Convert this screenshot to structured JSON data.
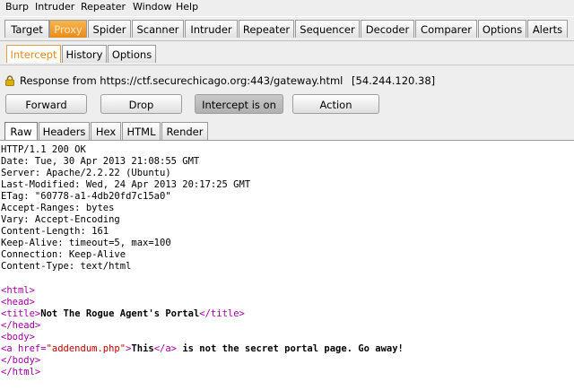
{
  "menu": [
    "Burp",
    "Intruder",
    "Repeater",
    "Window",
    "Help"
  ],
  "main_tabs": [
    "Target",
    "Proxy",
    "Spider",
    "Scanner",
    "Intruder",
    "Repeater",
    "Sequencer",
    "Decoder",
    "Comparer",
    "Options",
    "Alerts"
  ],
  "proxy_tabs": [
    "Intercept",
    "History",
    "Options"
  ],
  "request_info": {
    "text": "Response from https://ctf.securechicago.org:443/gateway.html",
    "ip": "[54.244.120.38]"
  },
  "buttons": {
    "forward": "Forward",
    "drop": "Drop",
    "intercept": "Intercept is on",
    "action": "Action"
  },
  "view_tabs": [
    "Raw",
    "Headers",
    "Hex",
    "HTML",
    "Render"
  ],
  "headers": [
    "HTTP/1.1 200 OK",
    "Date: Tue, 30 Apr 2013 21:08:55 GMT",
    "Server: Apache/2.2.22 (Ubuntu)",
    "Last-Modified: Wed, 24 Apr 2013 20:17:25 GMT",
    "ETag: \"60778-a1-4db20fd7c15a0\"",
    "Accept-Ranges: bytes",
    "Vary: Accept-Encoding",
    "Content-Length: 161",
    "Keep-Alive: timeout=5, max=100",
    "Connection: Keep-Alive",
    "Content-Type: text/html"
  ],
  "body": {
    "html_open": "<html>",
    "head_open": "<head>",
    "title_open": "<title>",
    "title_text": "Not The Rogue Agent's Portal",
    "title_close": "</title>",
    "head_close": "</head>",
    "body_open": "<body>",
    "a_open_start": "<a ",
    "a_href_attr": "href=",
    "a_href_val": "\"addendum.php\"",
    "a_open_end": ">",
    "a_text": "This",
    "a_close": "</a>",
    "after_link": " is not the secret portal page. Go away!",
    "body_close": "</body>",
    "html_close": "</html>"
  },
  "colors": {
    "proxy_tab": "#e88c1a",
    "tag": "#a000a0",
    "attr_value": "#c00000"
  }
}
